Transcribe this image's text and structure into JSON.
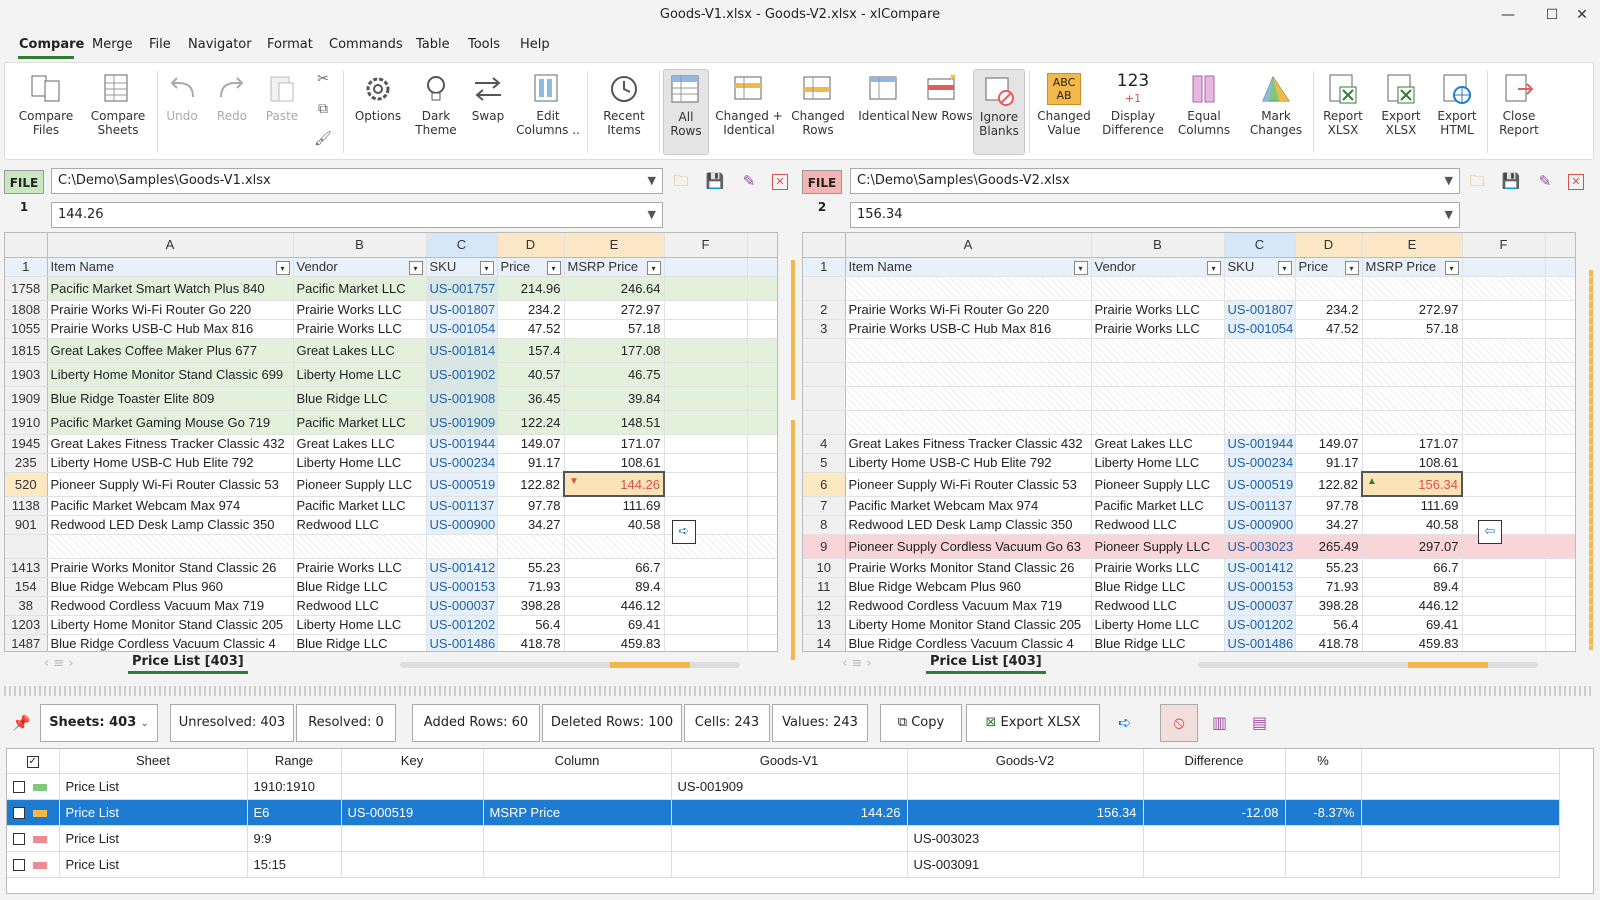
{
  "window": {
    "title": "Goods-V1.xlsx - Goods-V2.xlsx - xlCompare",
    "minimize": "—",
    "maximize": "☐",
    "close": "✕"
  },
  "menu": [
    "Compare",
    "Merge",
    "File",
    "Navigator",
    "Format",
    "Commands",
    "Table",
    "Tools",
    "Help"
  ],
  "ribbon": {
    "compare_files": "Compare Files",
    "compare_sheets": "Compare Sheets",
    "undo": "Undo",
    "redo": "Redo",
    "paste": "Paste",
    "options": "Options",
    "dark_theme": "Dark Theme",
    "swap": "Swap",
    "edit_columns": "Edit Columns ..",
    "recent_items": "Recent Items",
    "all_rows": "All Rows",
    "changed_identical": "Changed + Identical",
    "changed_rows": "Changed Rows",
    "identical": "Identical",
    "new_rows": "New Rows",
    "ignore_blanks": "Ignore Blanks",
    "changed_value": "Changed Value",
    "display_difference": "Display Difference",
    "equal_columns": "Equal Columns",
    "mark_changes": "Mark Changes",
    "report_xlsx": "Report XLSX",
    "export_xlsx": "Export XLSX",
    "export_html": "Export HTML",
    "close_report": "Close Report",
    "icon_123": "123",
    "icon_plus1": "+1",
    "icon_abc": "ABC",
    "icon_ab": "AB"
  },
  "file1": {
    "tag": "FILE 1",
    "path": "C:\\Demo\\Samples\\Goods-V1.xlsx",
    "cell_value": "144.26",
    "tag_color": "#c9e7c0"
  },
  "file2": {
    "tag": "FILE 2",
    "path": "C:\\Demo\\Samples\\Goods-V2.xlsx",
    "cell_value": "156.34",
    "tag_color": "#f5b5b5"
  },
  "columns": [
    "A",
    "B",
    "C",
    "D",
    "E",
    "F"
  ],
  "headers": {
    "rn": "1",
    "item": "Item Name",
    "vendor": "Vendor",
    "sku": "SKU",
    "price": "Price",
    "msrp": "MSRP Price",
    "filter": "▾"
  },
  "left_rows": [
    {
      "rn": "1758",
      "item": "Pacific Market Smart Watch Plus 840",
      "vendor": "Pacific Market LLC",
      "sku": "US-001757",
      "price": "214.96",
      "msrp": "246.64",
      "style": "green tall"
    },
    {
      "rn": "1808",
      "item": "Prairie Works Wi-Fi Router Go 220",
      "vendor": "Prairie Works LLC",
      "sku": "US-001807",
      "price": "234.2",
      "msrp": "272.97",
      "style": ""
    },
    {
      "rn": "1055",
      "item": "Prairie Works USB-C Hub Max 816",
      "vendor": "Prairie Works LLC",
      "sku": "US-001054",
      "price": "47.52",
      "msrp": "57.18",
      "style": ""
    },
    {
      "rn": "1815",
      "item": "Great Lakes Coffee Maker Plus 677",
      "vendor": "Great Lakes LLC",
      "sku": "US-001814",
      "price": "157.4",
      "msrp": "177.08",
      "style": "green tall"
    },
    {
      "rn": "1903",
      "item": "Liberty Home Monitor Stand Classic 699",
      "vendor": "Liberty Home LLC",
      "sku": "US-001902",
      "price": "40.57",
      "msrp": "46.75",
      "style": "green tall"
    },
    {
      "rn": "1909",
      "item": "Blue Ridge Toaster Elite 809",
      "vendor": "Blue Ridge LLC",
      "sku": "US-001908",
      "price": "36.45",
      "msrp": "39.84",
      "style": "green tall"
    },
    {
      "rn": "1910",
      "item": "Pacific Market Gaming Mouse Go 719",
      "vendor": "Pacific Market LLC",
      "sku": "US-001909",
      "price": "122.24",
      "msrp": "148.51",
      "style": "green tall"
    },
    {
      "rn": "1945",
      "item": "Great Lakes Fitness Tracker Classic 432",
      "vendor": "Great Lakes LLC",
      "sku": "US-001944",
      "price": "149.07",
      "msrp": "171.07",
      "style": ""
    },
    {
      "rn": "235",
      "item": "Liberty Home USB-C Hub Elite 792",
      "vendor": "Liberty Home LLC",
      "sku": "US-000234",
      "price": "91.17",
      "msrp": "108.61",
      "style": ""
    },
    {
      "rn": "520",
      "item": "Pioneer Supply Wi-Fi Router Classic 53",
      "vendor": "Pioneer Supply LLC",
      "sku": "US-000519",
      "price": "122.82",
      "msrp": "144.26",
      "style": "cur tall",
      "changed": true
    },
    {
      "rn": "1138",
      "item": "Pacific Market Webcam Max 974",
      "vendor": "Pacific Market LLC",
      "sku": "US-001137",
      "price": "97.78",
      "msrp": "111.69",
      "style": ""
    },
    {
      "rn": "901",
      "item": "Redwood LED Desk Lamp Classic 350",
      "vendor": "Redwood LLC",
      "sku": "US-000900",
      "price": "34.27",
      "msrp": "40.58",
      "style": ""
    },
    {
      "rn": "",
      "item": "",
      "vendor": "",
      "sku": "",
      "price": "",
      "msrp": "",
      "style": "empty tall"
    },
    {
      "rn": "1413",
      "item": "Prairie Works Monitor Stand Classic 26",
      "vendor": "Prairie Works LLC",
      "sku": "US-001412",
      "price": "55.23",
      "msrp": "66.7",
      "style": ""
    },
    {
      "rn": "154",
      "item": "Blue Ridge Webcam Plus 960",
      "vendor": "Blue Ridge LLC",
      "sku": "US-000153",
      "price": "71.93",
      "msrp": "89.4",
      "style": ""
    },
    {
      "rn": "38",
      "item": "Redwood Cordless Vacuum Max 719",
      "vendor": "Redwood LLC",
      "sku": "US-000037",
      "price": "398.28",
      "msrp": "446.12",
      "style": ""
    },
    {
      "rn": "1203",
      "item": "Liberty Home Monitor Stand Classic 205",
      "vendor": "Liberty Home LLC",
      "sku": "US-001202",
      "price": "56.4",
      "msrp": "69.41",
      "style": ""
    },
    {
      "rn": "1487",
      "item": "Blue Ridge Cordless Vacuum Classic 4",
      "vendor": "Blue Ridge LLC",
      "sku": "US-001486",
      "price": "418.78",
      "msrp": "459.83",
      "style": ""
    }
  ],
  "right_rows": [
    {
      "rn": "",
      "item": "",
      "vendor": "",
      "sku": "",
      "price": "",
      "msrp": "",
      "style": "empty tall"
    },
    {
      "rn": "2",
      "item": "Prairie Works Wi-Fi Router Go 220",
      "vendor": "Prairie Works LLC",
      "sku": "US-001807",
      "price": "234.2",
      "msrp": "272.97",
      "style": ""
    },
    {
      "rn": "3",
      "item": "Prairie Works USB-C Hub Max 816",
      "vendor": "Prairie Works LLC",
      "sku": "US-001054",
      "price": "47.52",
      "msrp": "57.18",
      "style": ""
    },
    {
      "rn": "",
      "item": "",
      "vendor": "",
      "sku": "",
      "price": "",
      "msrp": "",
      "style": "empty tall"
    },
    {
      "rn": "",
      "item": "",
      "vendor": "",
      "sku": "",
      "price": "",
      "msrp": "",
      "style": "empty tall"
    },
    {
      "rn": "",
      "item": "",
      "vendor": "",
      "sku": "",
      "price": "",
      "msrp": "",
      "style": "empty tall"
    },
    {
      "rn": "",
      "item": "",
      "vendor": "",
      "sku": "",
      "price": "",
      "msrp": "",
      "style": "empty tall"
    },
    {
      "rn": "4",
      "item": "Great Lakes Fitness Tracker Classic 432",
      "vendor": "Great Lakes LLC",
      "sku": "US-001944",
      "price": "149.07",
      "msrp": "171.07",
      "style": ""
    },
    {
      "rn": "5",
      "item": "Liberty Home USB-C Hub Elite 792",
      "vendor": "Liberty Home LLC",
      "sku": "US-000234",
      "price": "91.17",
      "msrp": "108.61",
      "style": ""
    },
    {
      "rn": "6",
      "item": "Pioneer Supply Wi-Fi Router Classic 53",
      "vendor": "Pioneer Supply LLC",
      "sku": "US-000519",
      "price": "122.82",
      "msrp": "156.34",
      "style": "cur tall",
      "changed": true
    },
    {
      "rn": "7",
      "item": "Pacific Market Webcam Max 974",
      "vendor": "Pacific Market LLC",
      "sku": "US-001137",
      "price": "97.78",
      "msrp": "111.69",
      "style": ""
    },
    {
      "rn": "8",
      "item": "Redwood LED Desk Lamp Classic 350",
      "vendor": "Redwood LLC",
      "sku": "US-000900",
      "price": "34.27",
      "msrp": "40.58",
      "style": ""
    },
    {
      "rn": "9",
      "item": "Pioneer Supply Cordless Vacuum Go 63",
      "vendor": "Pioneer Supply LLC",
      "sku": "US-003023",
      "price": "265.49",
      "msrp": "297.07",
      "style": "red tall"
    },
    {
      "rn": "10",
      "item": "Prairie Works Monitor Stand Classic 26",
      "vendor": "Prairie Works LLC",
      "sku": "US-001412",
      "price": "55.23",
      "msrp": "66.7",
      "style": ""
    },
    {
      "rn": "11",
      "item": "Blue Ridge Webcam Plus 960",
      "vendor": "Blue Ridge LLC",
      "sku": "US-000153",
      "price": "71.93",
      "msrp": "89.4",
      "style": ""
    },
    {
      "rn": "12",
      "item": "Redwood Cordless Vacuum Max 719",
      "vendor": "Redwood LLC",
      "sku": "US-000037",
      "price": "398.28",
      "msrp": "446.12",
      "style": ""
    },
    {
      "rn": "13",
      "item": "Liberty Home Monitor Stand Classic 205",
      "vendor": "Liberty Home LLC",
      "sku": "US-001202",
      "price": "56.4",
      "msrp": "69.41",
      "style": ""
    },
    {
      "rn": "14",
      "item": "Blue Ridge Cordless Vacuum Classic 4",
      "vendor": "Blue Ridge LLC",
      "sku": "US-001486",
      "price": "418.78",
      "msrp": "459.83",
      "style": ""
    }
  ],
  "sheet_tab": "Price List [403]",
  "status": {
    "sheets": "Sheets: 403",
    "unresolved": "Unresolved: 403",
    "resolved": "Resolved: 0",
    "added_rows": "Added Rows: 60",
    "deleted_rows": "Deleted Rows: 100",
    "cells": "Cells: 243",
    "values": "Values: 243",
    "copy": "Copy",
    "export_xlsx": "Export XLSX"
  },
  "results_header": {
    "sheet": "Sheet",
    "range": "Range",
    "key": "Key",
    "column": "Column",
    "v1": "Goods-V1",
    "v2": "Goods-V2",
    "diff": "Difference",
    "pct": "%"
  },
  "results": [
    {
      "sheet": "Price List",
      "range": "1910:1910",
      "key": "",
      "column": "",
      "v1": "US-001909",
      "v2": "",
      "diff": "",
      "pct": "",
      "marker": "#7ec97e"
    },
    {
      "sheet": "Price List",
      "range": "E6",
      "key": "US-000519",
      "column": "MSRP Price",
      "v1": "144.26",
      "v2": "156.34",
      "diff": "-12.08",
      "pct": "-8.37%",
      "marker": "#f2b84b"
    },
    {
      "sheet": "Price List",
      "range": "9:9",
      "key": "",
      "column": "",
      "v1": "",
      "v2": "US-003023",
      "diff": "",
      "pct": "",
      "marker": "#ee8a94"
    },
    {
      "sheet": "Price List",
      "range": "15:15",
      "key": "",
      "column": "",
      "v1": "",
      "v2": "US-003091",
      "diff": "",
      "pct": "",
      "marker": "#ee8a94"
    }
  ],
  "colors": {
    "accent": "#1e7bd2",
    "brand_green": "#2f7d32",
    "added": "#e3f1dc",
    "deleted": "#f9d5da",
    "changed": "#fbe3b8"
  }
}
